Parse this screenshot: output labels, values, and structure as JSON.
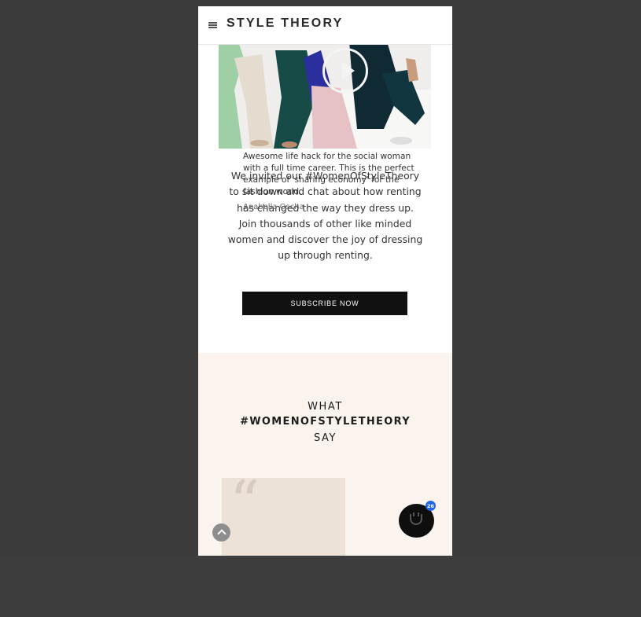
{
  "header": {
    "logo": "STYLE THEORY"
  },
  "intro": {
    "text": "We invited our #WomenOfStyleTheory to sit down and chat about how renting has changed the way they dress up. Join thousands of other like minded women and discover the joy of dressing up through renting."
  },
  "subscribe": {
    "label": "SUBSCRIBE NOW"
  },
  "testimonials": {
    "line1": "WHAT",
    "line2": "#WOMENOFSTYLETHEORY",
    "line3": "SAY",
    "quote": "Awesome life hack for the social woman with a full time career. This is the perfect example of 'sharing economy' for the fashion world.",
    "author": "Anabella Oscha"
  },
  "chat": {
    "badge": "26"
  },
  "colors": {
    "testimonial_bg": "#faf3ee",
    "button_bg": "#111111",
    "badge": "#1e66e8"
  },
  "icons": [
    "menu-icon",
    "play-icon",
    "quote-mark-icon",
    "scroll-top-icon",
    "chat-icon"
  ]
}
